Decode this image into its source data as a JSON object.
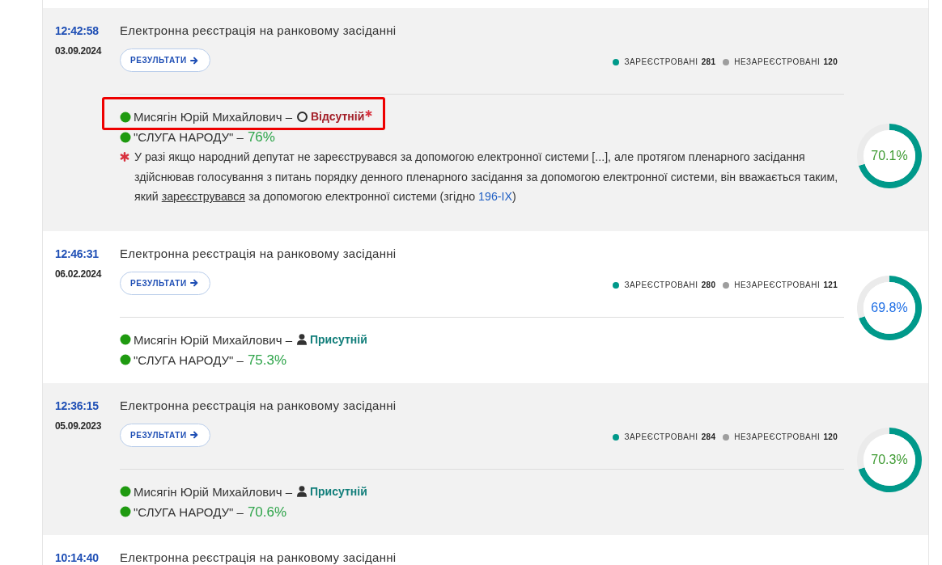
{
  "sessions": [
    {
      "time": "12:42:58",
      "date": "03.09.2024",
      "title": "Електронна реєстрація на ранковому засіданні",
      "button": "РЕЗУЛЬТАТИ",
      "legend": [
        {
          "label": "ЗАРЕЄСТРОВАНІ",
          "count": "281",
          "color": "#00998a"
        },
        {
          "label": "НЕЗАРЕЄСТРОВАНІ",
          "count": "120",
          "color": "#9e9e9e"
        }
      ],
      "deputy": {
        "name": "Мисягін Юрій Михайлович –",
        "highlighted": true,
        "status": {
          "kind": "absent",
          "label": "Відсутній",
          "asterisk": true
        }
      },
      "party": {
        "name": "\"СЛУГА НАРОДУ\" –",
        "share": "76%"
      },
      "note": {
        "before": "У разі якщо народний депутат не зареєструвався за допомогою електронної системи [...], але протягом пленарного засідання здійснював голосування з питань порядку денного пленарного засідання за допомогою електронної системи, він вважається таким, який ",
        "term": "зареєструвався",
        "middle": " за допомогою електронної системи (згідно ",
        "link": "196-IX",
        "after": ")"
      },
      "ring": {
        "label": "70.1%",
        "color": "#3f9b33",
        "chart_data": {
          "type": "donut",
          "values": [
            70.1,
            29.9
          ]
        }
      }
    },
    {
      "time": "12:46:31",
      "date": "06.02.2024",
      "title": "Електронна реєстрація на ранковому засіданні",
      "button": "РЕЗУЛЬТАТИ",
      "legend": [
        {
          "label": "ЗАРЕЄСТРОВАНІ",
          "count": "280",
          "color": "#00998a"
        },
        {
          "label": "НЕЗАРЕЄСТРОВАНІ",
          "count": "121",
          "color": "#9e9e9e"
        }
      ],
      "deputy": {
        "name": "Мисягін Юрій Михайлович –",
        "highlighted": false,
        "status": {
          "kind": "present",
          "label": "Присутній",
          "asterisk": false
        }
      },
      "party": {
        "name": "\"СЛУГА НАРОДУ\" –",
        "share": "75.3%"
      },
      "ring": {
        "label": "69.8%",
        "color": "#1f6fe5",
        "chart_data": {
          "type": "donut",
          "values": [
            69.8,
            30.2
          ]
        }
      }
    },
    {
      "time": "12:36:15",
      "date": "05.09.2023",
      "title": "Електронна реєстрація на ранковому засіданні",
      "button": "РЕЗУЛЬТАТИ",
      "legend": [
        {
          "label": "ЗАРЕЄСТРОВАНІ",
          "count": "284",
          "color": "#00998a"
        },
        {
          "label": "НЕЗАРЕЄСТРОВАНІ",
          "count": "120",
          "color": "#9e9e9e"
        }
      ],
      "deputy": {
        "name": "Мисягін Юрій Михайлович –",
        "highlighted": false,
        "status": {
          "kind": "present",
          "label": "Присутній",
          "asterisk": false
        }
      },
      "party": {
        "name": "\"СЛУГА НАРОДУ\" –",
        "share": "70.6%"
      },
      "ring": {
        "label": "70.3%",
        "color": "#3f9b33",
        "chart_data": {
          "type": "donut",
          "values": [
            70.3,
            29.7
          ]
        }
      }
    },
    {
      "time": "10:14:40",
      "title": "Електронна реєстрація на ранковому засіданні"
    }
  ]
}
